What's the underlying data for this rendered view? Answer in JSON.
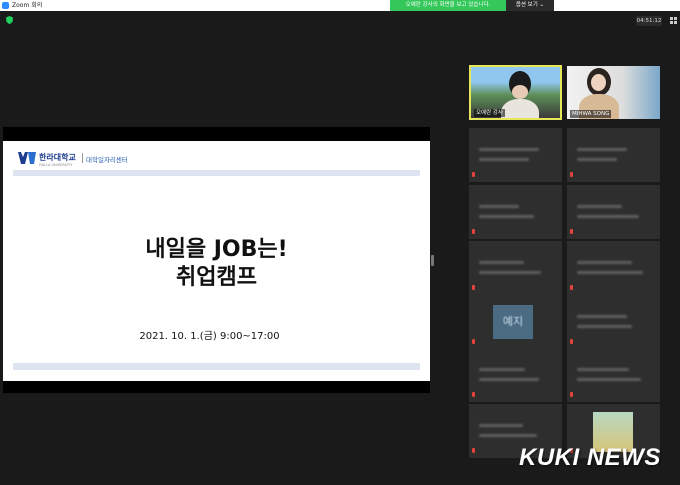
{
  "window": {
    "title": "Zoom 회의"
  },
  "share_banner": "오예란 강사의 화면을 보고 있습니다.",
  "view_options": "옵션 보기 ⌄",
  "timer": "04:51:12",
  "slide": {
    "logo_name": "한라대학교",
    "logo_sub": "HALLA UNIVERSITY",
    "logo_dept": "대학일자리센터",
    "title": "내일을 JOB는!",
    "subtitle": "취업캠프",
    "date": "2021. 10. 1.(금) 9:00~17:00"
  },
  "participants": {
    "speaker": {
      "name": "오예란 강사"
    },
    "second": {
      "name": "MIHWA SONG"
    },
    "placeholder_tile_text": "예지"
  },
  "watermark": "KUKI NEWS",
  "colors": {
    "accent_green": "#34c759",
    "active_border": "#e6e65a",
    "brand_blue": "#1e3f8f"
  }
}
